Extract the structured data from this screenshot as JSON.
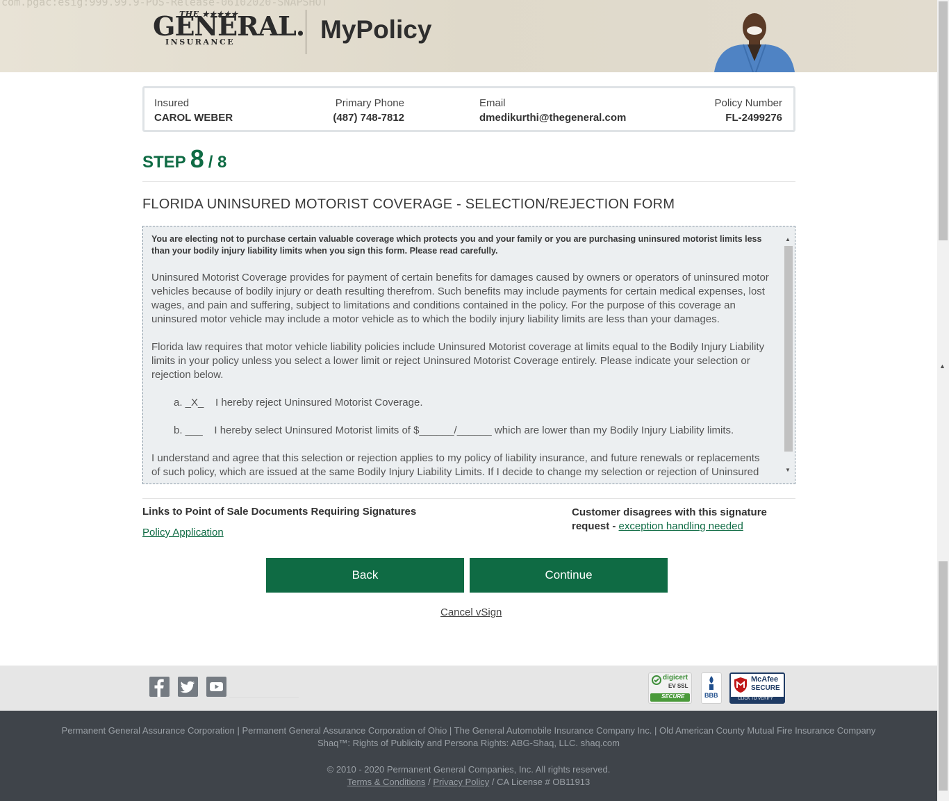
{
  "build_tag": "com.pgac:esig:999.99.9-POS-Release-06102020-SNAPSHOT",
  "brand": {
    "logo_top": "THE ★★★★★",
    "logo_main": "GENERAL.",
    "logo_sub": "INSURANCE",
    "app_title": "MyPolicy"
  },
  "insured": {
    "insured_label": "Insured",
    "insured_value": "CAROL WEBER",
    "phone_label": "Primary Phone",
    "phone_value": "(487) 748-7812",
    "email_label": "Email",
    "email_value": "dmedikurthi@thegeneral.com",
    "policy_label": "Policy Number",
    "policy_value": "FL-2499276"
  },
  "step": {
    "word": "STEP",
    "current": "8",
    "total": "/ 8"
  },
  "form": {
    "title": "FLORIDA UNINSURED MOTORIST COVERAGE - SELECTION/REJECTION FORM",
    "lead": "You are electing not to purchase certain valuable coverage which protects you and your family or you are purchasing uninsured motorist limits less than your bodily injury liability limits when you sign this form. Please read carefully.",
    "para1": "Uninsured Motorist Coverage provides for payment of certain benefits for damages caused by owners or operators of uninsured motor vehicles because of bodily injury or death resulting therefrom. Such benefits may include payments for certain medical expenses, lost wages, and pain and suffering, subject to limitations and conditions contained in the policy. For the purpose of this coverage an uninsured motor vehicle may include a motor vehicle as to which the bodily injury liability limits are less than your damages.",
    "para2": "Florida law requires that motor vehicle liability policies include Uninsured Motorist coverage at limits equal to the Bodily Injury Liability limits in your policy unless you select a lower limit or reject Uninsured Motorist Coverage entirely. Please indicate your selection or rejection below.",
    "option_a": "a. _X_    I hereby reject Uninsured Motorist Coverage.",
    "option_b": "b. ___    I hereby select Uninsured Motorist limits of $______/______ which are lower than my Bodily Injury Liability limits.",
    "para3": "I understand and agree that this selection or rejection applies to my policy of liability insurance, and future renewals or replacements of such policy, which are issued at the same Bodily Injury Liability Limits. If I decide to change my selection or rejection of Uninsured"
  },
  "links": {
    "title": "Links to Point of Sale Documents Requiring Signatures",
    "policy_application": "Policy Application",
    "disagree_text": "Customer disagrees with this signature request - ",
    "exception_link": "exception handling needed"
  },
  "actions": {
    "back": "Back",
    "continue": "Continue",
    "cancel": "Cancel vSign"
  },
  "seals": {
    "digicert_top": "digicert",
    "digicert_mid": "EV SSL",
    "digicert_bottom": "SECURE",
    "bbb": "BBB",
    "mcafee_top": "McAfee",
    "mcafee_mid": "SECURE",
    "mcafee_bottom": "CLICK TO VERIFY"
  },
  "footer": {
    "companies": "Permanent General Assurance Corporation | Permanent General Assurance Corporation of Ohio | The General Automobile Insurance Company Inc. | Old American County Mutual Fire Insurance Company",
    "shaq": "Shaq™: Rights of Publicity and Persona Rights: ABG-Shaq, LLC. shaq.com",
    "copyright": "© 2010 - 2020 Permanent General Companies, Inc. All rights reserved.",
    "terms": "Terms & Conditions",
    "sep": "/",
    "privacy": "Privacy Policy",
    "license": "/ CA License # OB11913"
  },
  "colors": {
    "brand_green": "#0f6b44",
    "footer_dark": "#3f444a",
    "footer_light": "#e6e6e6"
  },
  "icons": [
    "facebook-icon",
    "twitter-icon",
    "youtube-icon",
    "scroll-up-icon",
    "scroll-down-icon"
  ]
}
